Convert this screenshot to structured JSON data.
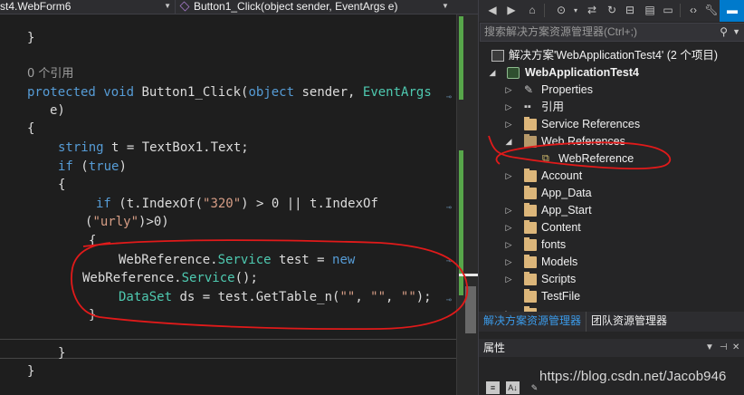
{
  "editor": {
    "class_dropdown": "st4.WebForm6",
    "method_dropdown": "Button1_Click(object sender, EventArgs e)",
    "code": {
      "l1": "}",
      "refcount": "0 个引用",
      "sig_kw1": "protected",
      "sig_kw2": "void",
      "sig_name": " Button1_Click(",
      "sig_kw3": "object",
      "sig_sender": " sender, ",
      "sig_type": "EventArgs",
      "sig_cont": "e)",
      "brace_open": "{",
      "decl_kw": "string",
      "decl_rest": " t = TextBox1.Text;",
      "if_kw": "if",
      "if_open": " (",
      "true_kw": "true",
      "if_close": ")",
      "brace2": "{",
      "if2_kw": "if",
      "if2_a": " (t.IndexOf(",
      "str320": "\"320\"",
      "if2_b": ") > 0 || t.IndexOf",
      "if2_c": "(",
      "strurly": "\"urly\"",
      "if2_d": ")>0)",
      "brace3": "{",
      "ws_ns1": "WebReference.",
      "ws_ty1": "Service",
      "ws_mid": " test = ",
      "ws_new": "new",
      "ws_ns2": "WebReference.",
      "ws_ty2": "Service",
      "ws_end": "();",
      "ds_ty": "DataSet",
      "ds_a": " ds = test.GetTable_n(",
      "s1": "\"\"",
      "c1": ", ",
      "s2": "\"\"",
      "c2": ", ",
      "s3": "\"\"",
      "ds_end": ");",
      "brace3c": "}",
      "brace2c": "}",
      "brace1c": "}"
    }
  },
  "solution_explorer": {
    "search_placeholder": "搜索解决方案资源管理器(Ctrl+;)",
    "tree": {
      "solution": "解决方案'WebApplicationTest4' (2 个项目)",
      "project": "WebApplicationTest4",
      "properties": "Properties",
      "references": "引用",
      "service_references": "Service References",
      "web_references": "Web References",
      "web_reference": "WebReference",
      "account": "Account",
      "app_data": "App_Data",
      "app_start": "App_Start",
      "content": "Content",
      "fonts": "fonts",
      "models": "Models",
      "scripts": "Scripts",
      "testfile": "TestFile"
    },
    "tabs": {
      "solution_explorer": "解决方案资源管理器",
      "team_explorer": "团队资源管理器"
    }
  },
  "properties_panel": {
    "title": "属性"
  },
  "watermark": "https://blog.csdn.net/Jacob946",
  "colors": {
    "keyword": "#569cd6",
    "type": "#4ec9b0",
    "string": "#d69d85",
    "annotation": "#e11a1a",
    "change_bar": "#57a64a",
    "accent": "#007acc"
  }
}
